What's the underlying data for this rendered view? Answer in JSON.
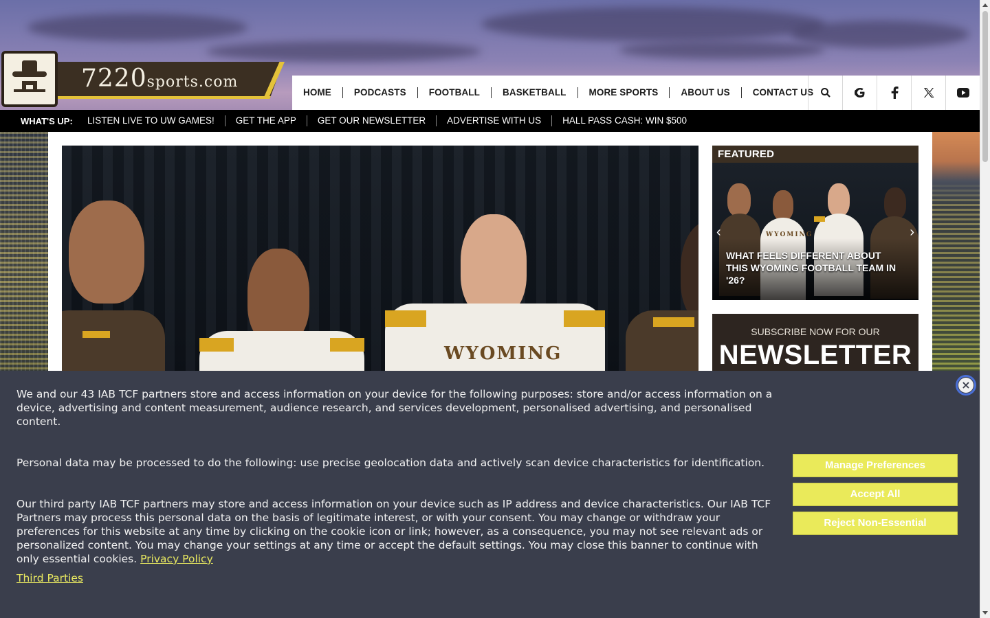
{
  "site": {
    "logo_main": "7220",
    "logo_suffix": "sports.com"
  },
  "nav": {
    "items": [
      "HOME",
      "PODCASTS",
      "FOOTBALL",
      "BASKETBALL",
      "MORE SPORTS",
      "ABOUT US",
      "CONTACT US"
    ],
    "icons": [
      "search-icon",
      "google-icon",
      "facebook-icon",
      "x-twitter-icon",
      "youtube-icon"
    ]
  },
  "whatsup": {
    "title": "WHAT'S UP:",
    "links": [
      "LISTEN LIVE TO UW GAMES!",
      "GET THE APP",
      "GET OUR NEWSLETTER",
      "ADVERTISE WITH US",
      "HALL PASS CASH: WIN $500"
    ]
  },
  "hero": {
    "jersey_word": "WYOMING"
  },
  "featured": {
    "header": "FEATURED",
    "caption": "WHAT FEELS DIFFERENT ABOUT THIS WYOMING FOOTBALL TEAM IN '26?",
    "jersey_word": "WYOMING"
  },
  "newsletter": {
    "subtitle": "SUBSCRIBE NOW FOR OUR",
    "title": "NEWSLETTER"
  },
  "cookie": {
    "paragraph1": "We and our 43 IAB TCF partners store and access information on your device for the following purposes: store and/or access information on a device, advertising and content measurement, audience research, and services development, personalised advertising, and personalised content.",
    "paragraph2": "Personal data may be processed to do the following: use precise geolocation data and actively scan device characteristics for identification.",
    "paragraph3": "Our third party IAB TCF partners may store and access information on your device such as IP address and device characteristics. Our IAB TCF Partners may process this personal data on the basis of legitimate interest, or with your consent. You may change or withdraw your preferences for this website at any time by clicking on the cookie icon or link; however, as a consequence, you may not see relevant ads or personalized content. You may change your settings at any time or accept the default settings. You may close this banner to continue with only essential cookies.",
    "privacy_link": "Privacy Policy",
    "third_parties_link": "Third Parties",
    "buttons": {
      "manage": "Manage Preferences",
      "accept": "Accept All",
      "reject": "Reject Non-Essential"
    },
    "close_symbol": "×"
  },
  "colors": {
    "brand_brown": "#3b2f22",
    "brand_gold": "#e4c23a",
    "cookie_bg": "#3a3e4c",
    "cookie_button": "#eaea5a",
    "link_yellow": "#e8e860"
  }
}
